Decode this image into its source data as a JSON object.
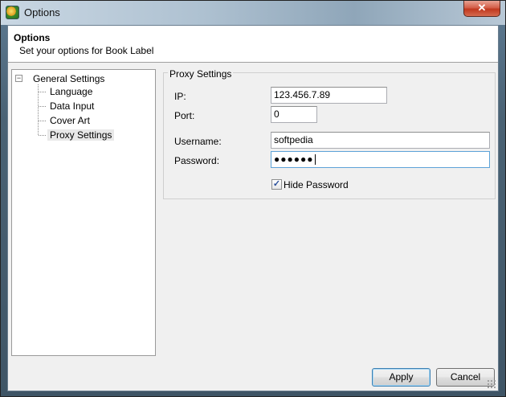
{
  "window": {
    "title": "Options",
    "close_glyph": "✕",
    "app_icon": "book-label-app-icon"
  },
  "header": {
    "title": "Options",
    "subtitle": "Set your options for Book Label"
  },
  "tree": {
    "root": {
      "label": "General Settings",
      "expander": "−"
    },
    "items": [
      {
        "label": "Language",
        "selected": false
      },
      {
        "label": "Data Input",
        "selected": false
      },
      {
        "label": "Cover Art",
        "selected": false
      },
      {
        "label": "Proxy Settings",
        "selected": true
      }
    ]
  },
  "proxy": {
    "group_title": "Proxy Settings",
    "ip_label": "IP:",
    "ip_value": "123.456.7.89",
    "port_label": "Port:",
    "port_value": "0",
    "username_label": "Username:",
    "username_value": "softpedia",
    "password_label": "Password:",
    "password_masked": "●●●●●●",
    "hide_password_label": "Hide Password",
    "hide_password_checked": true,
    "check_glyph": "✓"
  },
  "buttons": {
    "apply": "Apply",
    "cancel": "Cancel"
  },
  "colors": {
    "title_bar": "#aec1d1",
    "close_button": "#c0391f",
    "focus_border": "#5ea3d8",
    "default_button_border": "#3c7fb1"
  }
}
